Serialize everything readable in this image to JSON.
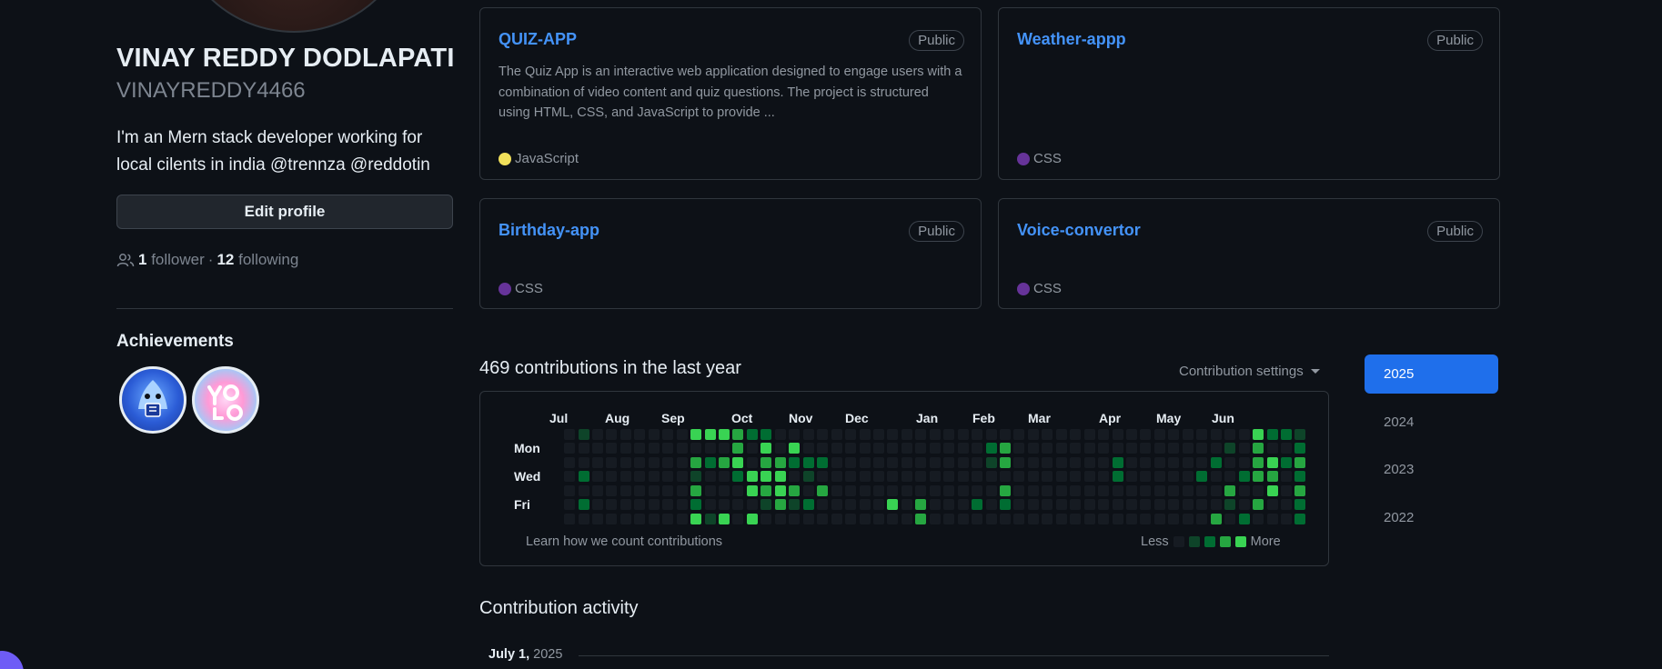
{
  "profile": {
    "name": "VINAY REDDY DODLAPATI",
    "login": "VINAYREDDY4466",
    "bio": "I'm an Mern stack developer working for local cilents in india @trennza @reddotin",
    "edit_label": "Edit profile",
    "followers_count": "1",
    "followers_label": "follower",
    "separator": "·",
    "following_count": "12",
    "following_label": "following",
    "achievements_title": "Achievements"
  },
  "repos": [
    {
      "name": "QUIZ-APP",
      "visibility": "Public",
      "description": "The Quiz App is an interactive web application designed to engage users with a combination of video content and quiz questions. The project is structured using HTML, CSS, and JavaScript to provide ...",
      "language": "JavaScript",
      "language_color": "#f1e05a"
    },
    {
      "name": "Weather-appp",
      "visibility": "Public",
      "description": "",
      "language": "CSS",
      "language_color": "#663399"
    },
    {
      "name": "Birthday-app",
      "visibility": "Public",
      "description": "",
      "language": "CSS",
      "language_color": "#663399"
    },
    {
      "name": "Voice-convertor",
      "visibility": "Public",
      "description": "",
      "language": "CSS",
      "language_color": "#663399"
    }
  ],
  "contributions": {
    "title": "469 contributions in the last year",
    "settings_label": "Contribution settings",
    "months": [
      "Jul",
      "Aug",
      "Sep",
      "Oct",
      "Nov",
      "Dec",
      "Jan",
      "Feb",
      "Mar",
      "Apr",
      "May",
      "Jun"
    ],
    "days": [
      "Mon",
      "Wed",
      "Fri"
    ],
    "learn_label": "Learn how we count contributions",
    "legend_less": "Less",
    "legend_more": "More",
    "level_colors": [
      "#161b22",
      "#0e4429",
      "#006d32",
      "#26a641",
      "#39d353"
    ],
    "weeks": 53,
    "cells": [
      [
        1,
        0,
        1
      ],
      [
        1,
        3,
        2
      ],
      [
        1,
        5,
        2
      ],
      [
        9,
        0,
        4
      ],
      [
        9,
        2,
        3
      ],
      [
        9,
        3,
        1
      ],
      [
        9,
        4,
        3
      ],
      [
        9,
        5,
        2
      ],
      [
        9,
        6,
        4
      ],
      [
        10,
        0,
        4
      ],
      [
        10,
        2,
        2
      ],
      [
        10,
        6,
        1
      ],
      [
        11,
        0,
        4
      ],
      [
        11,
        2,
        3
      ],
      [
        11,
        6,
        4
      ],
      [
        12,
        0,
        3
      ],
      [
        12,
        1,
        3
      ],
      [
        12,
        2,
        4
      ],
      [
        12,
        3,
        2
      ],
      [
        13,
        0,
        2
      ],
      [
        13,
        3,
        4
      ],
      [
        13,
        4,
        4
      ],
      [
        13,
        6,
        4
      ],
      [
        14,
        0,
        2
      ],
      [
        14,
        1,
        4
      ],
      [
        14,
        2,
        3
      ],
      [
        14,
        3,
        4
      ],
      [
        14,
        4,
        3
      ],
      [
        14,
        5,
        1
      ],
      [
        15,
        2,
        3
      ],
      [
        15,
        3,
        4
      ],
      [
        15,
        4,
        4
      ],
      [
        15,
        5,
        3
      ],
      [
        16,
        1,
        4
      ],
      [
        16,
        2,
        2
      ],
      [
        16,
        4,
        3
      ],
      [
        16,
        5,
        1
      ],
      [
        17,
        2,
        2
      ],
      [
        17,
        3,
        1
      ],
      [
        17,
        5,
        2
      ],
      [
        18,
        2,
        2
      ],
      [
        18,
        4,
        3
      ],
      [
        23,
        5,
        4
      ],
      [
        25,
        5,
        3
      ],
      [
        25,
        6,
        3
      ],
      [
        29,
        5,
        2
      ],
      [
        30,
        1,
        2
      ],
      [
        30,
        2,
        1
      ],
      [
        31,
        1,
        3
      ],
      [
        31,
        2,
        3
      ],
      [
        31,
        4,
        3
      ],
      [
        31,
        5,
        2
      ],
      [
        39,
        2,
        2
      ],
      [
        39,
        3,
        2
      ],
      [
        45,
        3,
        2
      ],
      [
        46,
        2,
        2
      ],
      [
        46,
        6,
        3
      ],
      [
        47,
        1,
        1
      ],
      [
        47,
        4,
        3
      ],
      [
        47,
        5,
        1
      ],
      [
        48,
        3,
        2
      ],
      [
        48,
        6,
        2
      ],
      [
        49,
        0,
        4
      ],
      [
        49,
        1,
        3
      ],
      [
        49,
        2,
        3
      ],
      [
        49,
        3,
        3
      ],
      [
        49,
        5,
        3
      ],
      [
        50,
        0,
        2
      ],
      [
        50,
        2,
        4
      ],
      [
        50,
        3,
        3
      ],
      [
        50,
        4,
        4
      ],
      [
        51,
        0,
        2
      ],
      [
        51,
        2,
        2
      ],
      [
        52,
        0,
        1
      ],
      [
        52,
        1,
        2
      ],
      [
        52,
        2,
        3
      ],
      [
        52,
        3,
        2
      ],
      [
        52,
        4,
        3
      ],
      [
        52,
        5,
        2
      ],
      [
        52,
        6,
        2
      ]
    ]
  },
  "years": [
    "2025",
    "2024",
    "2023",
    "2022"
  ],
  "active_year": "2025",
  "activity": {
    "title": "Contribution activity",
    "date_month": "July 1,",
    "date_year": "2025"
  }
}
